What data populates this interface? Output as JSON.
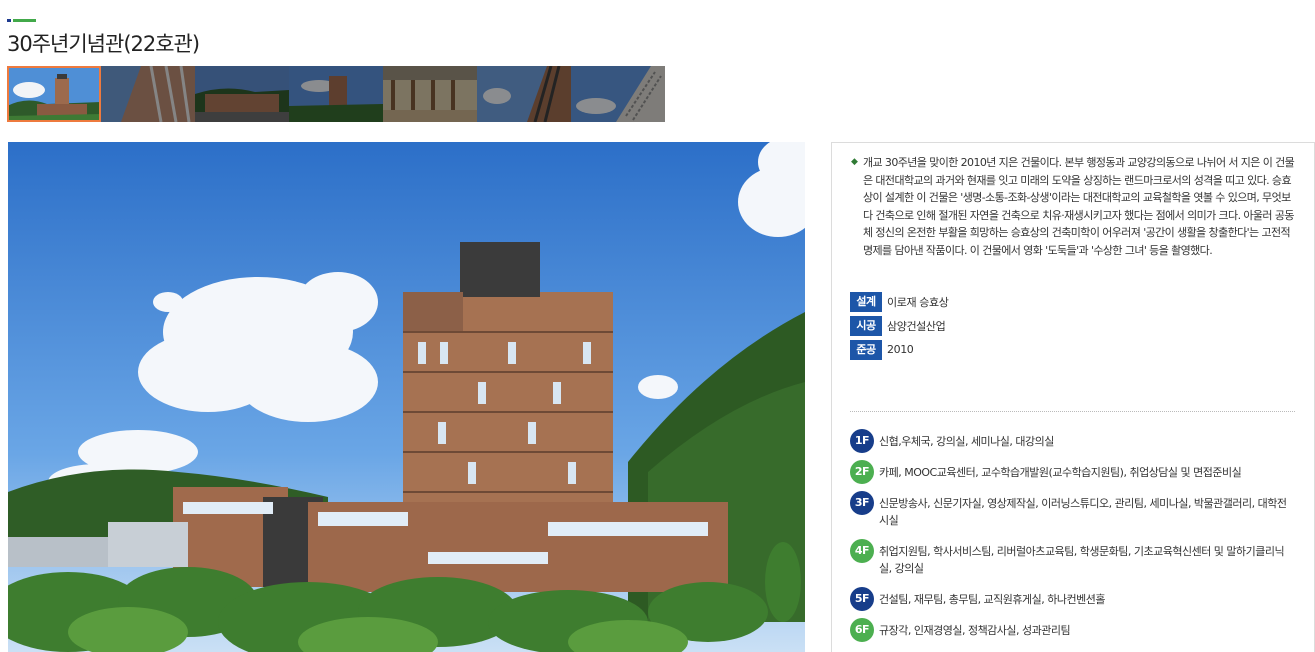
{
  "page": {
    "title": "30주년기념관(22호관)",
    "accent_navy": "#1d3a8f",
    "accent_green": "#42a94a",
    "thumb_active_border": "#ee7a3e"
  },
  "gallery": {
    "thumbnails": [
      {
        "label": "photo-1",
        "active": true
      },
      {
        "label": "photo-2",
        "active": false
      },
      {
        "label": "photo-3",
        "active": false
      },
      {
        "label": "photo-4",
        "active": false
      },
      {
        "label": "photo-5",
        "active": false
      },
      {
        "label": "photo-6",
        "active": false
      },
      {
        "label": "photo-7",
        "active": false
      }
    ]
  },
  "info": {
    "description": "개교 30주년을 맞이한 2010년 지은 건물이다. 본부 행정동과 교양강의동으로 나뉘어 서 지은 이 건물은 대전대학교의 과거와 현재를 잇고 미래의 도약을 상징하는 랜드마크로서의 성격을 띠고 있다. 승효상이 설계한 이 건물은 '생명-소통-조화-상생'이라는 대전대학교의 교육철학을 엿볼 수 있으며, 무엇보다 건축으로 인해 절개된 자연을 건축으로 치유·재생시키고자 했다는 점에서 의미가 크다. 아울러 공동체 정신의 온전한 부활을 희망하는 승효상의 건축미학이 어우러져 '공간이 생활을 창출한다'는 고전적 명제를 담아낸 작품이다. 이 건물에서 영화 '도둑들'과 '수상한 그녀' 등을 촬영했다.",
    "meta": [
      {
        "label": "설계",
        "value": "이로재 승효상"
      },
      {
        "label": "시공",
        "value": "삼양건설산업"
      },
      {
        "label": "준공",
        "value": "2010"
      }
    ],
    "meta_badge_color": "#1d56a8",
    "floors": [
      {
        "badge": "1F",
        "color": "#173d8a",
        "text": "신협,우체국, 강의실, 세미나실, 대강의실"
      },
      {
        "badge": "2F",
        "color": "#4caf50",
        "text": "카페, MOOC교육센터, 교수학습개발원(교수학습지원팀), 취업상담실 및 면접준비실"
      },
      {
        "badge": "3F",
        "color": "#173d8a",
        "text": "신문방송사, 신문기자실, 영상제작실, 이러닝스튜디오, 관리팀, 세미나실, 박물관갤러리, 대학전시실"
      },
      {
        "badge": "4F",
        "color": "#4caf50",
        "text": "취업지원팀, 학사서비스팀, 리버럴아츠교육팀, 학생문화팀, 기초교육혁신센터 및 말하기클리닉실, 강의실"
      },
      {
        "badge": "5F",
        "color": "#173d8a",
        "text": "건설팀, 재무팀, 총무팀, 교직원휴게실, 하나컨벤션홀"
      },
      {
        "badge": "6F",
        "color": "#4caf50",
        "text": "규장각, 인재경영실, 정책감사실, 성과관리팀"
      }
    ]
  }
}
